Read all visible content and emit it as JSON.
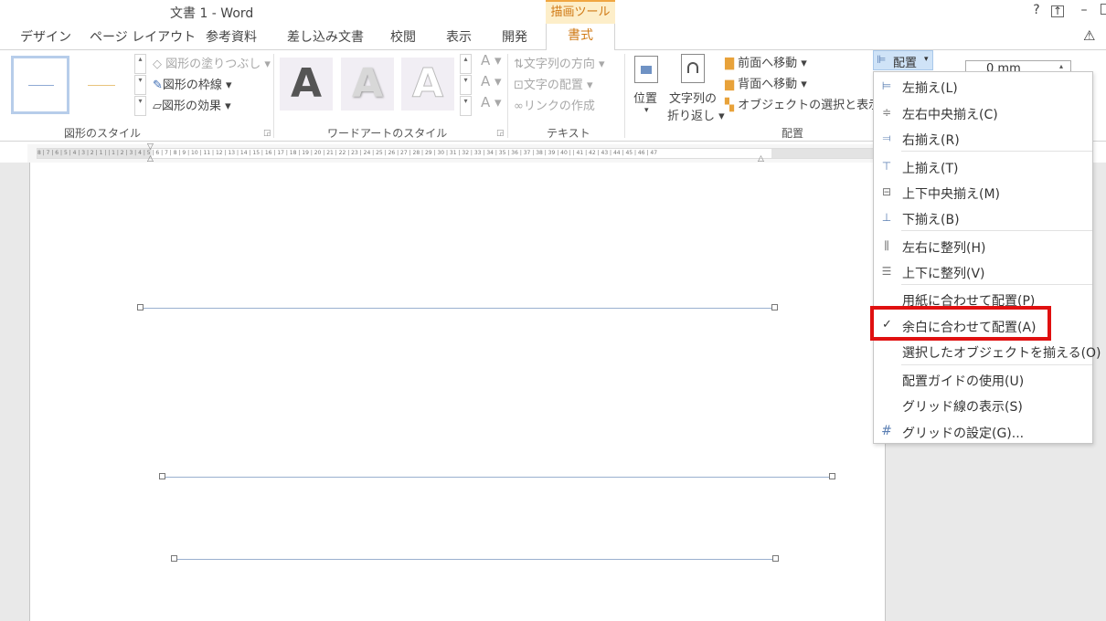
{
  "window": {
    "title": "文書 1 - Word",
    "context_group": "描画ツール",
    "help": "?",
    "restore": "⊡",
    "minimize": "–"
  },
  "tabs": [
    "デザイン",
    "ページ レイアウト",
    "参考資料",
    "差し込み文書",
    "校閲",
    "表示",
    "開発"
  ],
  "active_tab": "書式",
  "ribbon": {
    "shape_styles": {
      "fill": "図形の塗りつぶし",
      "outline": "図形の枠線",
      "effect": "図形の効果",
      "label": "図形のスタイル"
    },
    "wordart": {
      "letter": "A",
      "label": "ワードアートのスタイル"
    },
    "text": {
      "direction": "文字列の方向",
      "align": "文字の配置",
      "link": "リンクの作成",
      "label": "テキスト"
    },
    "arrange": {
      "position": "位置",
      "wrap_line1": "文字列の",
      "wrap_line2": "折り返し",
      "bring_forward": "前面へ移動",
      "send_backward": "背面へ移動",
      "selection_pane": "オブジェクトの選択と表示",
      "align_button": "配置",
      "label": "配置"
    },
    "size_value": "0 mm"
  },
  "ruler": {
    "ticks": "8 | 7 | 6 | 5 | 4 | 3 | 2 | 1 |   | 1 | 2 | 3 | 4 | 5 | 6 | 7 | 8 | 9 | 10 | 11 | 12 | 13 | 14 | 15 | 16 | 17 | 18 | 19 | 20 | 21 | 22 | 23 | 24 | 25 | 26 | 27 | 28 | 29 | 30 | 31 | 32 | 33 | 34 | 35 | 36 | 37 | 38 | 39 | 40 |   | 41 | 42 | 43 | 44 | 45 | 46 | 47"
  },
  "menu": {
    "items": [
      {
        "label": "左揃え(L)",
        "icon": "align-left-icon"
      },
      {
        "label": "左右中央揃え(C)",
        "icon": "align-center-icon"
      },
      {
        "label": "右揃え(R)",
        "icon": "align-right-icon"
      },
      {
        "label": "上揃え(T)",
        "icon": "align-top-icon"
      },
      {
        "label": "上下中央揃え(M)",
        "icon": "align-middle-icon"
      },
      {
        "label": "下揃え(B)",
        "icon": "align-bottom-icon"
      },
      {
        "label": "左右に整列(H)",
        "icon": "distribute-horizontal-icon"
      },
      {
        "label": "上下に整列(V)",
        "icon": "distribute-vertical-icon"
      },
      {
        "label": "用紙に合わせて配置(P)",
        "icon": ""
      },
      {
        "label": "余白に合わせて配置(A)",
        "icon": "check-icon",
        "checked": true
      },
      {
        "label": "選択したオブジェクトを揃える(O)",
        "icon": ""
      },
      {
        "label": "配置ガイドの使用(U)",
        "icon": ""
      },
      {
        "label": "グリッド線の表示(S)",
        "icon": ""
      },
      {
        "label": "グリッドの設定(G)...",
        "icon": "grid-icon"
      }
    ]
  },
  "colors": {
    "accent": "#d07a16",
    "highlight": "#e01010",
    "line": "#9ab0cf"
  }
}
